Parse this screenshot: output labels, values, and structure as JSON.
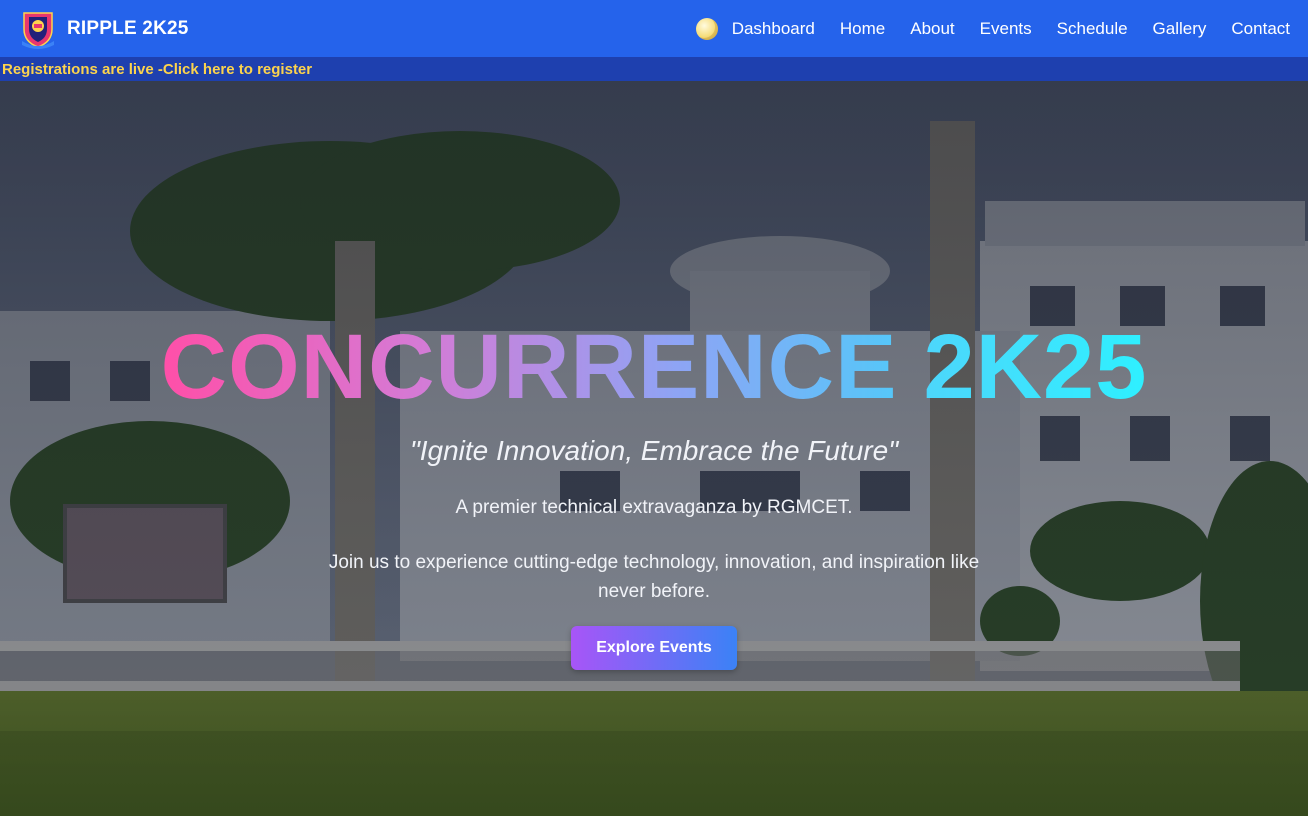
{
  "colors": {
    "navbar": "#2563eb",
    "ticker_bg": "#1e40af",
    "ticker_text": "#fcd34d",
    "title_gradient": [
      "#ff4fa8",
      "#d57ad5",
      "#8ea4f5",
      "#55c7f9",
      "#2ef0ff"
    ],
    "cta_gradient": [
      "#a855f7",
      "#3b82f6"
    ]
  },
  "navbar": {
    "brand": "RIPPLE 2K25",
    "logo_icon": "college-crest-icon",
    "theme_toggle_icon": "moon-icon",
    "links": [
      "Dashboard",
      "Home",
      "About",
      "Events",
      "Schedule",
      "Gallery",
      "Contact"
    ]
  },
  "ticker": {
    "text": "Registrations are live -Click here to register"
  },
  "hero": {
    "title_part1": "CONCURRENCE",
    "title_part2": "2K25",
    "tagline": "\"Ignite Innovation, Embrace the Future\"",
    "subtitle": "A premier technical extravaganza by RGMCET.",
    "description": "Join us to experience cutting-edge technology, innovation, and inspiration like never before.",
    "cta_label": "Explore Events",
    "background_image": "campus-building-photo"
  }
}
